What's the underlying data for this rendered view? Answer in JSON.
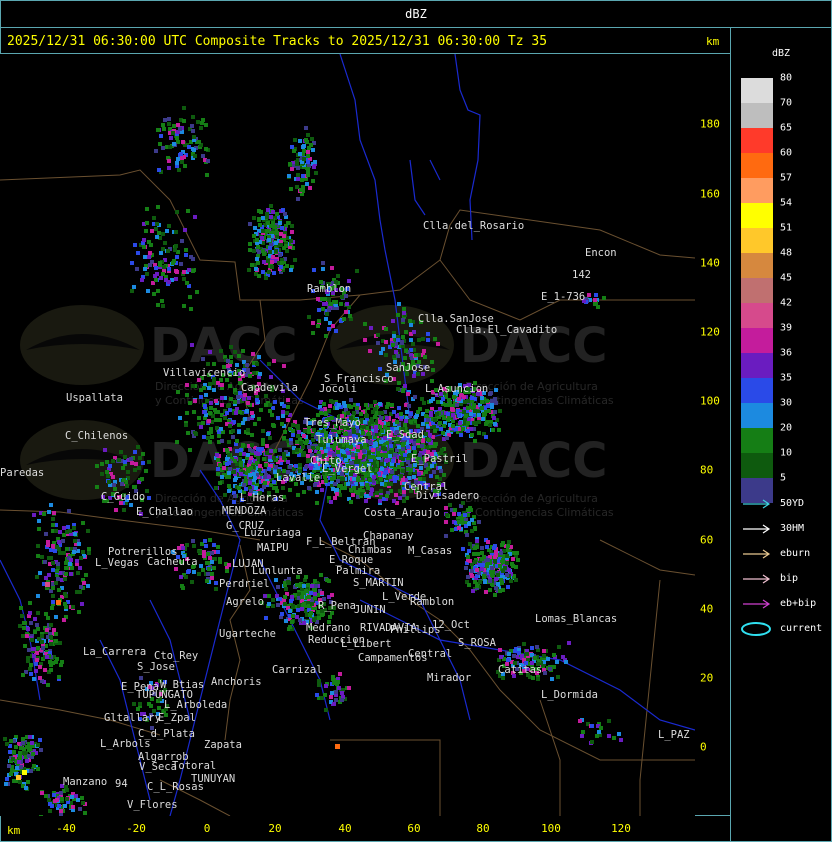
{
  "header": {
    "title": "dBZ"
  },
  "map_title": "2025/12/31 06:30:00 UTC Composite Tracks to 2025/12/31 06:30:00 Tz 35",
  "axis": {
    "unit_top": "km",
    "unit_bottom": "km",
    "x_ticks": [
      "-40",
      "-20",
      "0",
      "20",
      "40",
      "60",
      "80",
      "100",
      "120"
    ],
    "y_ticks": [
      "180",
      "160",
      "140",
      "120",
      "100",
      "80",
      "60",
      "40",
      "20",
      "0"
    ]
  },
  "legend": {
    "title": "dBZ",
    "scale": [
      {
        "label": "80",
        "color": "#dcdcdc"
      },
      {
        "label": "70",
        "color": "#bebebe"
      },
      {
        "label": "65",
        "color": "#ff3a2a"
      },
      {
        "label": "60",
        "color": "#ff6a10"
      },
      {
        "label": "57",
        "color": "#ff9c60"
      },
      {
        "label": "54",
        "color": "#ffff00"
      },
      {
        "label": "51",
        "color": "#ffc82a"
      },
      {
        "label": "48",
        "color": "#d6883e"
      },
      {
        "label": "45",
        "color": "#c07070"
      },
      {
        "label": "42",
        "color": "#d64a8c"
      },
      {
        "label": "39",
        "color": "#c41c9c"
      },
      {
        "label": "36",
        "color": "#6a1cc0"
      },
      {
        "label": "35",
        "color": "#2a4ae8"
      },
      {
        "label": "30",
        "color": "#1c8ae0"
      },
      {
        "label": "20",
        "color": "#157e15"
      },
      {
        "label": "10",
        "color": "#0e5a0e"
      },
      {
        "label": "5",
        "color": "#3c3a8a"
      }
    ],
    "tracks": [
      {
        "label": "50YD",
        "color": "#40d0e0"
      },
      {
        "label": "30HM",
        "color": "#ffffff"
      },
      {
        "label": "eburn",
        "color": "#e8c890"
      },
      {
        "label": "bip",
        "color": "#f0c0d0"
      },
      {
        "label": "eb+bip",
        "color": "#d040d0"
      },
      {
        "label": "current",
        "color": "#30e0f0",
        "icon": "ellipse"
      }
    ]
  },
  "watermark": {
    "name": "DACC",
    "line1": "Dirección de Agricultura",
    "line2": "y Contingencias Climáticas"
  },
  "places": [
    "Clla.del_Rosario",
    "Encon",
    "142",
    "E_1-736",
    "Ramblon",
    "Clla.SanJose",
    "Clla.El_Cavadito",
    "Villavicencio",
    "Capdevila",
    "S_Francisco",
    "SanJose",
    "L_Asuncion",
    "Uspallata",
    "Jocoli",
    "Tres_Mayo",
    "C_Chilenos",
    "Tulumaya",
    "E_Sdad",
    "E_Pastril",
    "Chito",
    "L_Vergel",
    "L_Heras",
    "Lavalle",
    "Paredas",
    "Central",
    "Divisadero",
    "C_Guido",
    "E_Challao",
    "MENDOZA",
    "Costa_Araujo",
    "G_CRUZ",
    "Luzuriaga",
    "F_L_Beltran",
    "MAIPU",
    "Chimbas",
    "Chapanay",
    "M_Casas",
    "Potrerillos",
    "L_Vegas",
    "Cacheuta",
    "LUJAN",
    "Lunlunta",
    "E_Roque",
    "Palmira",
    "S_MARTIN",
    "Perdriel",
    "Agrelo",
    "L_Verde",
    "Ramblon",
    "R_Pena",
    "JUNIN",
    "Lomas_Blancas",
    "12_Oct",
    "Ugarteche",
    "RIVADAVIA",
    "Phillips",
    "S_ROSA",
    "Reduccion",
    "Medrano",
    "L_Libert",
    "La_Carrera",
    "Cto_Rey",
    "S_Jose",
    "Campamentos",
    "Central",
    "Catitas",
    "Carrizal",
    "Anchoris",
    "E_Pena",
    "W_Btias",
    "TUPUNGATO",
    "Mirador",
    "L_Dormida",
    "L_Arboleda",
    "Gltallary",
    "E_Zpal",
    "C_d_Plata",
    "L_PAZ",
    "L_Arbols",
    "Zapata",
    "Algarrob",
    "V_Seca",
    "Totoral",
    "Manzano",
    "TUNUYAN",
    "C_L_Rosas",
    "V_Flores",
    "94"
  ]
}
